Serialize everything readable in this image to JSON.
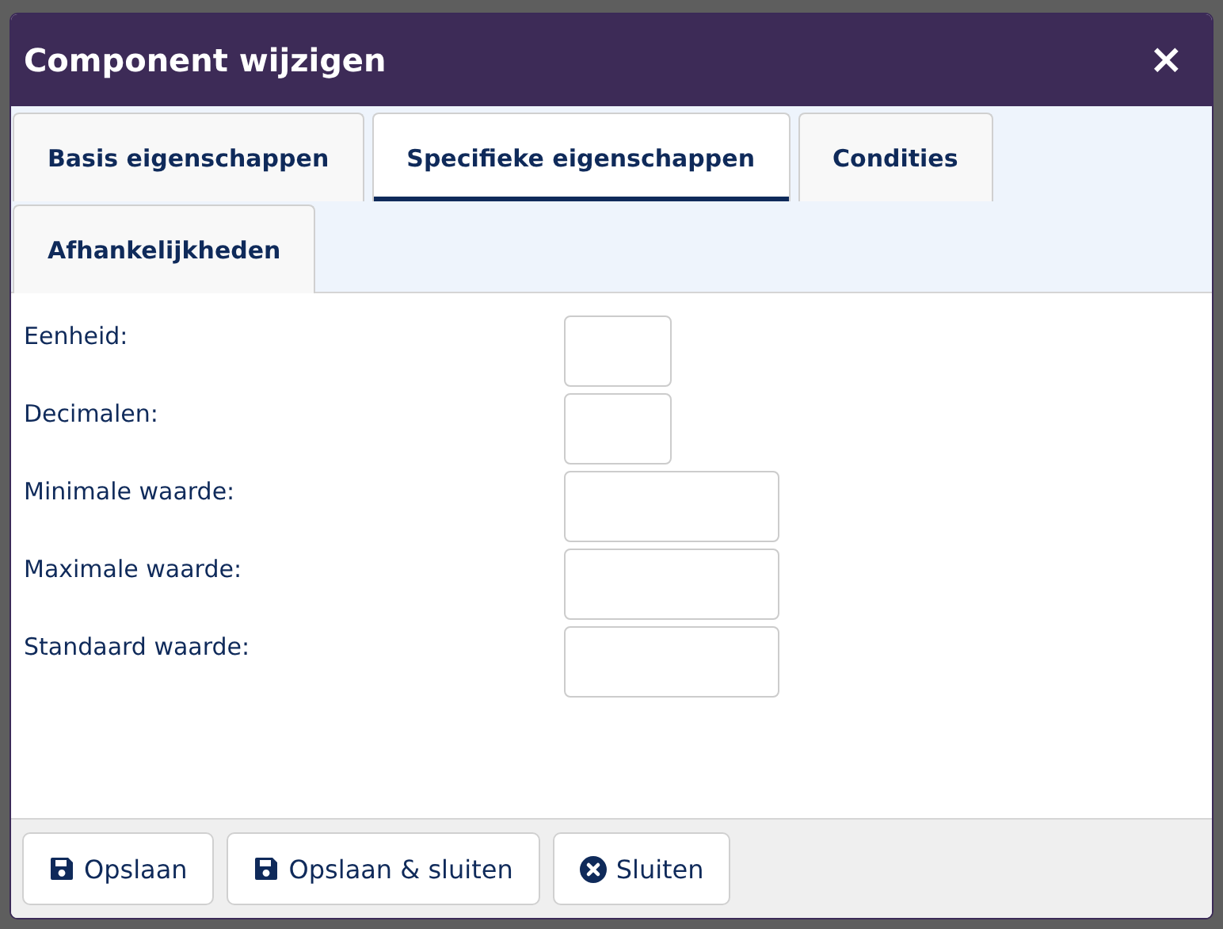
{
  "window": {
    "title": "Component wijzigen",
    "close": "×"
  },
  "tabs": [
    {
      "label": "Basis eigenschappen",
      "selected": false
    },
    {
      "label": "Specifieke eigenschappen",
      "selected": true
    },
    {
      "label": "Condities",
      "selected": false
    },
    {
      "label": "Afhankelijkheden",
      "selected": false
    }
  ],
  "fields": [
    {
      "label": "Eenheid:",
      "kind": "short"
    },
    {
      "label": "Decimalen:",
      "kind": "short"
    },
    {
      "label": "Minimale waarde:",
      "kind": "long"
    },
    {
      "label": "Maximale waarde:",
      "kind": "long"
    },
    {
      "label": "Standaard waarde:",
      "kind": "long"
    }
  ],
  "buttons": [
    {
      "label": "Opslaan",
      "kind": "save"
    },
    {
      "label": "Opslaan & sluiten",
      "kind": "save"
    },
    {
      "label": "Sluiten",
      "kind": "close"
    }
  ]
}
